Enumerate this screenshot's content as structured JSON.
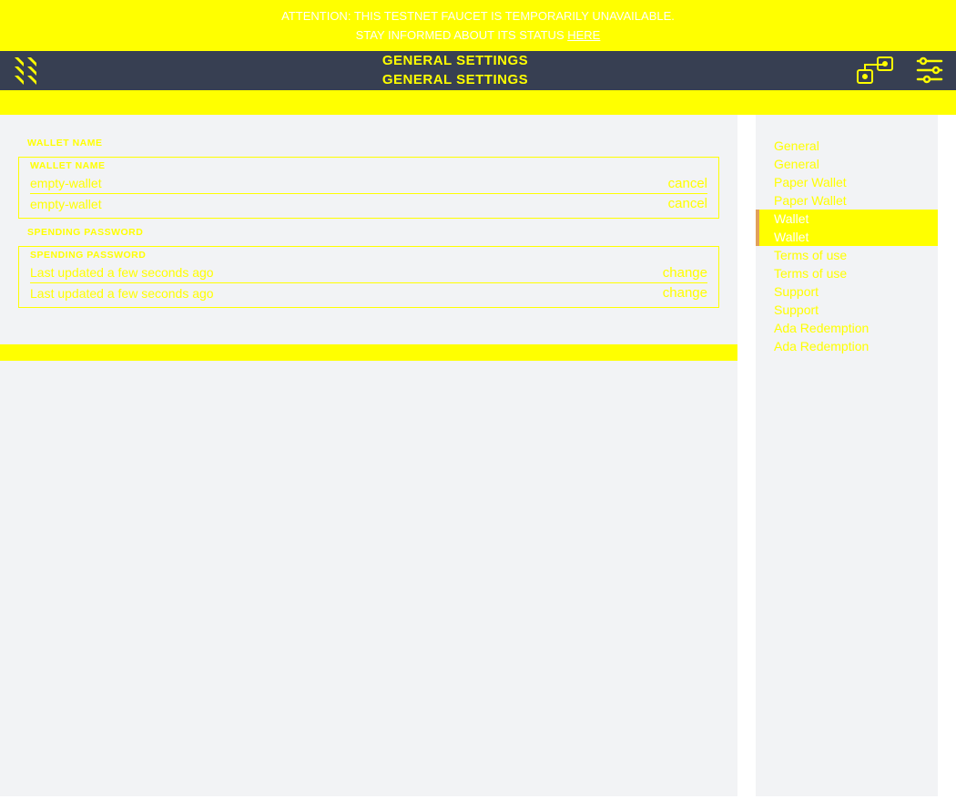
{
  "banner": {
    "line1": "ATTENTION: THIS TESTNET FAUCET IS TEMPORARILY UNAVAILABLE.",
    "line2_prefix": "STAY INFORMED ABOUT ITS STATUS ",
    "line2_link": "HERE"
  },
  "topbar": {
    "title": "GENERAL SETTINGS"
  },
  "walletName": {
    "label": "WALLET NAME",
    "value": "empty-wallet",
    "action": "cancel"
  },
  "spendingPassword": {
    "label": "SPENDING PASSWORD",
    "value": "Last updated a few seconds ago",
    "action": "change"
  },
  "sidebar": {
    "items": [
      {
        "label": "General",
        "active": false
      },
      {
        "label": "General",
        "active": false
      },
      {
        "label": "Paper Wallet",
        "active": false
      },
      {
        "label": "Paper Wallet",
        "active": false
      },
      {
        "label": "Wallet",
        "active": true
      },
      {
        "label": "Wallet",
        "active": true
      },
      {
        "label": "Terms of use",
        "active": false
      },
      {
        "label": "Terms of use",
        "active": false
      },
      {
        "label": "Support",
        "active": false
      },
      {
        "label": "Support",
        "active": false
      },
      {
        "label": "Ada Redemption",
        "active": false
      },
      {
        "label": "Ada Redemption",
        "active": false
      }
    ]
  }
}
